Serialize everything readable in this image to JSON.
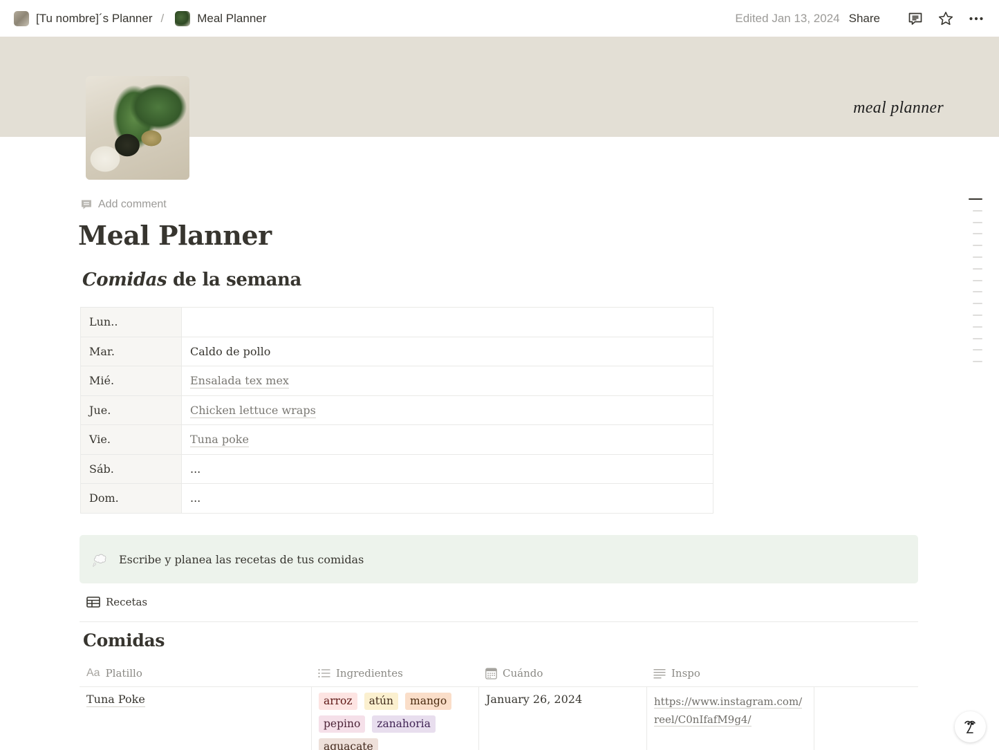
{
  "topbar": {
    "breadcrumb": [
      {
        "label": "[Tu nombre]´s Planner",
        "icon": "planner-thumbnail-icon"
      },
      {
        "label": "Meal Planner",
        "icon": "vegetables-thumbnail-icon"
      }
    ],
    "separator": "/",
    "edited": "Edited Jan 13, 2024",
    "share_label": "Share",
    "icons": [
      "comments-icon",
      "favorite-star-icon",
      "more-options-icon"
    ]
  },
  "cover": {
    "text": "meal planner",
    "color": "#e3dfd5"
  },
  "page": {
    "add_comment": "Add comment",
    "title": "Meal Planner"
  },
  "week": {
    "heading_italic": "Comidas",
    "heading_rest": " de la semana",
    "rows": [
      {
        "day": "Lun..",
        "meal": "",
        "linked": false
      },
      {
        "day": "Mar.",
        "meal": "Caldo de pollo",
        "linked": false
      },
      {
        "day": "Mié.",
        "meal": "Ensalada tex mex",
        "linked": true
      },
      {
        "day": "Jue.",
        "meal": "Chicken lettuce wraps",
        "linked": true
      },
      {
        "day": "Vie.",
        "meal": "Tuna poke",
        "linked": true
      },
      {
        "day": "Sáb.",
        "meal": "...",
        "linked": false
      },
      {
        "day": "Dom.",
        "meal": "...",
        "linked": false
      }
    ]
  },
  "callout": {
    "icon": "thought-balloon-icon",
    "text": "Escribe y planea las recetas de tus comidas",
    "background": "#edf3ec"
  },
  "database": {
    "view_tab": "Recetas",
    "title": "Comidas",
    "columns": [
      {
        "label": "Platillo",
        "icon": "title-aa-icon"
      },
      {
        "label": "Ingredientes",
        "icon": "multi-select-list-icon"
      },
      {
        "label": "Cuándo",
        "icon": "calendar-icon"
      },
      {
        "label": "Inspo",
        "icon": "text-lines-icon"
      }
    ],
    "rows": [
      {
        "platillo": "Tuna Poke",
        "ingredientes": [
          {
            "label": "arroz",
            "bg": "#fde4e2",
            "fg": "#5d1715"
          },
          {
            "label": "atún",
            "bg": "#fbf0cf",
            "fg": "#402c1b"
          },
          {
            "label": "mango",
            "bg": "#fadec9",
            "fg": "#49290e"
          },
          {
            "label": "pepino",
            "bg": "#f5e0e9",
            "fg": "#4c2337"
          },
          {
            "label": "zanahoria",
            "bg": "#e8deee",
            "fg": "#412454"
          },
          {
            "label": "aguacate",
            "bg": "#eee0da",
            "fg": "#442a1e"
          }
        ],
        "cuando": "January 26, 2024",
        "inspo_line1": "https://www.instagram.com/",
        "inspo_line2": "reel/C0nIfafM9g4/"
      }
    ]
  },
  "toc": {
    "items": 15,
    "active_index": 0
  },
  "help_button": {
    "label": "?"
  }
}
